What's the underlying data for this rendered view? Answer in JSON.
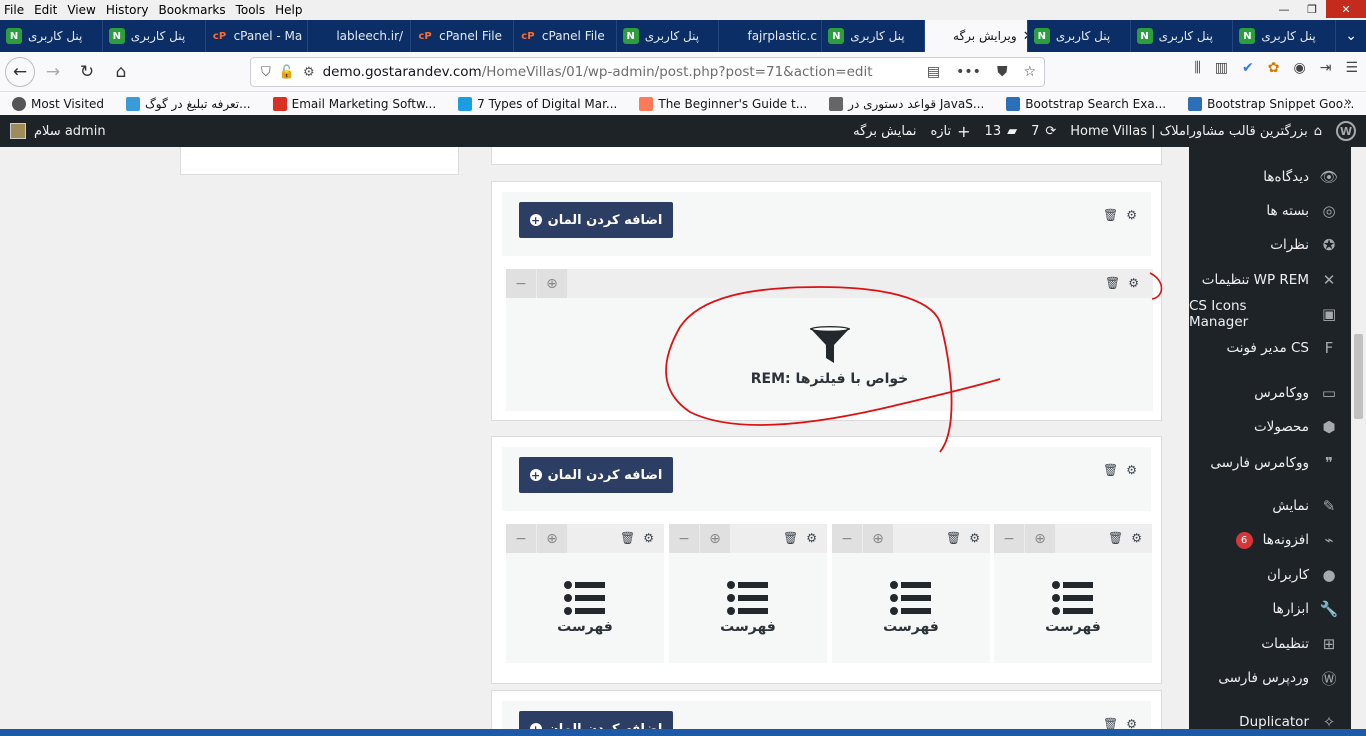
{
  "menu": [
    "File",
    "Edit",
    "View",
    "History",
    "Bookmarks",
    "Tools",
    "Help"
  ],
  "tabs": [
    {
      "title": "پنل کاربری",
      "icon": "nav"
    },
    {
      "title": "پنل کاربری",
      "icon": "nav"
    },
    {
      "title": "cPanel - Ma",
      "icon": "cp"
    },
    {
      "title": "lableech.ir/",
      "icon": "none"
    },
    {
      "title": "cPanel File",
      "icon": "cp"
    },
    {
      "title": "cPanel File",
      "icon": "cp"
    },
    {
      "title": "پنل کاربری",
      "icon": "nav"
    },
    {
      "title": "fajrplastic.c",
      "icon": "none"
    },
    {
      "title": "پنل کاربری",
      "icon": "nav"
    },
    {
      "title": "ویرایش برگه",
      "icon": "none",
      "active": true
    },
    {
      "title": "پنل کاربری",
      "icon": "nav"
    },
    {
      "title": "پنل کاربری",
      "icon": "nav"
    },
    {
      "title": "پنل کاربری",
      "icon": "nav"
    }
  ],
  "url": {
    "host": "demo.gostarandev.com",
    "path": "/HomeVillas/01/wp-admin/post.php?post=71&action=edit"
  },
  "bookmarks": [
    {
      "label": "Most Visited",
      "color": "#555"
    },
    {
      "label": "تعرفه تبلیغ در گوگ...",
      "color": "#3a9bd8"
    },
    {
      "label": "Email Marketing Softw...",
      "color": "#d93025"
    },
    {
      "label": "7 Types of Digital Mar...",
      "color": "#1b9de2"
    },
    {
      "label": "The Beginner's Guide t...",
      "color": "#ff7a59"
    },
    {
      "label": "قواعد دستوری در JavaS...",
      "color": "#666"
    },
    {
      "label": "Bootstrap Search Exa...",
      "color": "#2c6fb7"
    },
    {
      "label": "Bootstrap Snippet Goo...",
      "color": "#2c6fb7"
    }
  ],
  "wpbar": {
    "greeting": "سلام admin",
    "site": "بزرگترین قالب مشاوراملاک | Home Villas",
    "updates": "7",
    "comments": "13",
    "new": "تازه",
    "view_page": "نمایش برگه"
  },
  "builder": {
    "add_element": "اضافه کردن المان",
    "rem_widget": "REM: خواص با فیلترها",
    "list_widget": "فهرست"
  },
  "sidebar": [
    {
      "label": "دیدگاه‌ها",
      "icon": "eye-icon"
    },
    {
      "label": "بسته ها",
      "icon": "package-icon"
    },
    {
      "label": "نظرات",
      "icon": "star-icon"
    },
    {
      "label": "تنظیمات WP REM",
      "icon": "tools-icon"
    },
    {
      "label": "CS Icons Manager",
      "icon": "icons-icon"
    },
    {
      "label": "مدیر فونت CS",
      "icon": "font-icon"
    },
    {
      "label": "ووکامرس",
      "icon": "woo-icon"
    },
    {
      "label": "محصولات",
      "icon": "box-icon"
    },
    {
      "label": "ووکامرس فارسی",
      "icon": "quote-icon"
    },
    {
      "label": "نمایش",
      "icon": "brush-icon"
    },
    {
      "label": "افزونه‌ها",
      "icon": "plugin-icon",
      "badge": "6"
    },
    {
      "label": "کاربران",
      "icon": "user-icon"
    },
    {
      "label": "ابزارها",
      "icon": "wrench-icon"
    },
    {
      "label": "تنظیمات",
      "icon": "settings-icon"
    },
    {
      "label": "وردپرس فارسی",
      "icon": "wp-icon"
    },
    {
      "label": "Duplicator",
      "icon": "duplicator-icon"
    }
  ]
}
